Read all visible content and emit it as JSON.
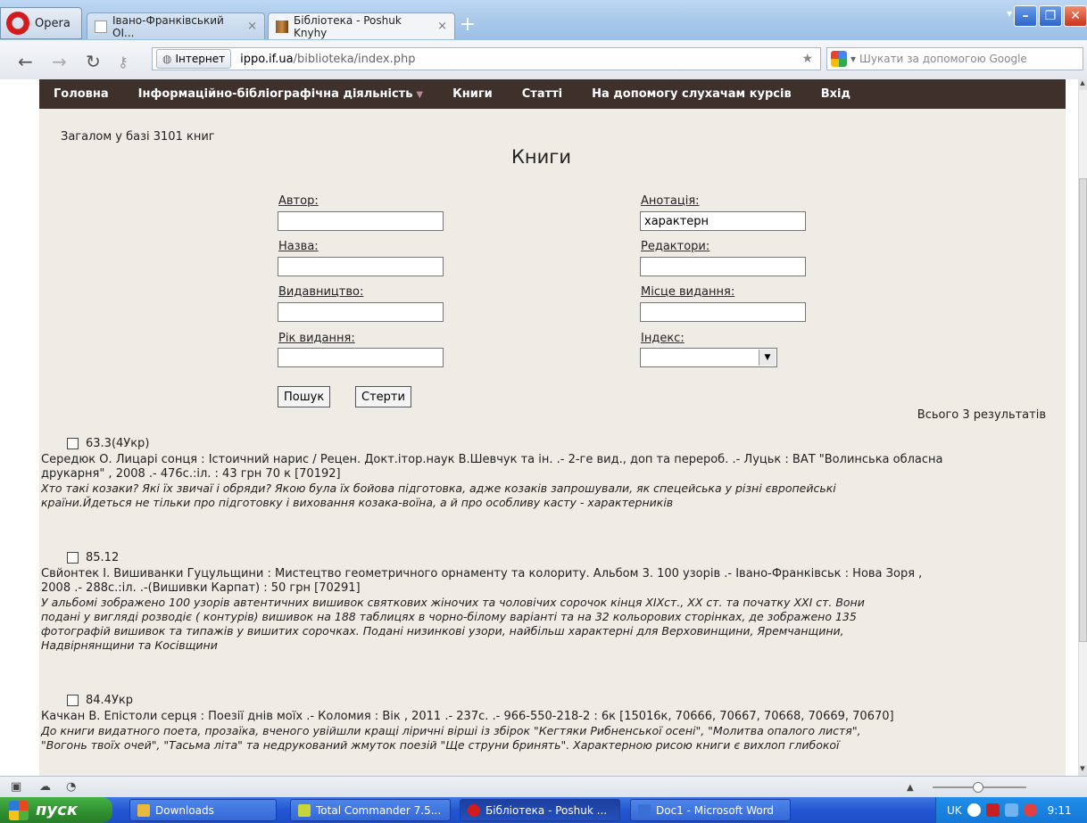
{
  "browser": {
    "menu_label": "Opera",
    "tabs": [
      {
        "label": "Івано-Франківський ОІ...",
        "active": false
      },
      {
        "label": "Бібліотека - Poshuk Knyhy",
        "active": true
      }
    ],
    "new_tab": "+",
    "tab_close": "×",
    "address": {
      "security_chip": "Інтернет",
      "url_host": "ippo.if.ua",
      "url_path": "/biblioteka/index.php"
    },
    "search_placeholder": "Шукати за допомогою Google",
    "window_controls": {
      "minimize": "–",
      "maximize": "❐",
      "close": "✕"
    }
  },
  "site": {
    "nav": [
      {
        "label": "Головна"
      },
      {
        "label": "Інформаційно-бібліографічна діяльність",
        "has_dropdown": true
      },
      {
        "label": "Книги"
      },
      {
        "label": "Статті"
      },
      {
        "label": "На допомогу слухачам курсів"
      },
      {
        "label": "Вхід"
      }
    ],
    "total_text": "Загалом у базі 3101 книг",
    "heading": "Книги",
    "form": {
      "author_label": "Автор:",
      "author_value": "",
      "title_label": "Назва:",
      "title_value": "",
      "publisher_label": "Видавництво:",
      "publisher_value": "",
      "year_label": "Рік видання:",
      "year_value": "",
      "annotation_label": "Анотація:",
      "annotation_value": "характерн",
      "editors_label": "Редактори:",
      "editors_value": "",
      "place_label": "Місце видання:",
      "place_value": "",
      "index_label": "Індекс:",
      "index_value": "",
      "search_button": "Пошук",
      "clear_button": "Стерти"
    },
    "results_count": "Всього 3 результатів",
    "results": [
      {
        "code": "63.3(4Укр)",
        "desc_lines": [
          "Середюк О. Лицарі сонця : Істоичний нарис / Рецен. Докт.ітор.наук В.Шевчук та ін. .- 2-ге вид., доп та перероб. .- Луцьк : ВАТ \"Волинська обласна",
          "друкарня\" , 2008 .- 476с.:іл. : 43 грн 70 к [70192]"
        ],
        "ann_lines": [
          "Хто такі козаки? Які їх звичаї і обряди? Якою була їх бойова підготовка, адже козаків запрошували, як спецейська у різні європейські",
          "країни.Йдеться не тільки про підготовку і виховання козака-воїна, а й про особливу касту - характерників"
        ]
      },
      {
        "code": "85.12",
        "desc_lines": [
          "Свйонтек І. Вишиванки Гуцульщини : Мистецтво геометричного орнаменту та колориту. Альбом 3. 100 узорів .- Івано-Франківськ : Нова Зоря ,",
          "2008 .- 288с.:іл. .-(Вишивки Карпат) : 50 грн [70291]"
        ],
        "ann_lines": [
          "У альбомі зображено 100 узорів автентичних вишивок святкових жіночих та чоловічих сорочок кінця ХІХст., ХХ ст. та початку ХХІ ст. Вони",
          "подані у вигляді розводіє ( контурів) вишивок на 188 таблицях в чорно-білому варіанті та на 32 кольорових сторінках, де зображено 135",
          "фотографій вишивок та типажів у вишитих сорочках. Подані низинкові узори, найбільш характерні для Верховинщини, Яремчанщини,",
          "Надвірнянщини та Косівщини"
        ]
      },
      {
        "code": "84.4Укр",
        "desc_lines": [
          "Качкан В. Епістоли серця : Поезії днів моїх .- Коломия : Вік , 2011 .- 237с. .- 966-550-218-2 : 6к [15016к, 70666, 70667, 70668, 70669, 70670]"
        ],
        "ann_lines": [
          "До книги видатного поета, прозаїка, вченого увійшли кращі ліричні вірші із збірок \"Кегтяки Рибненської осені\", \"Молитва опалого листя\",",
          "\"Вогонь твоїх очей\", \"Тасьма літа\" та недрукований жмуток поезій \"Ще струни бринять\". Характерною рисою книги є вихлоп глибокої"
        ]
      }
    ]
  },
  "taskbar": {
    "start_label": "пуск",
    "items": [
      {
        "label": "Downloads",
        "color": "#e8b93a",
        "active": false
      },
      {
        "label": "Total Commander 7.5...",
        "color": "#c9d33a",
        "active": false
      },
      {
        "label": "Бібліотека - Poshuk ...",
        "color": "#d31b1b",
        "active": true
      },
      {
        "label": "Doc1 - Microsoft Word",
        "color": "#3a6fd3",
        "active": false
      }
    ],
    "lang": "UK",
    "clock": "9:11"
  }
}
